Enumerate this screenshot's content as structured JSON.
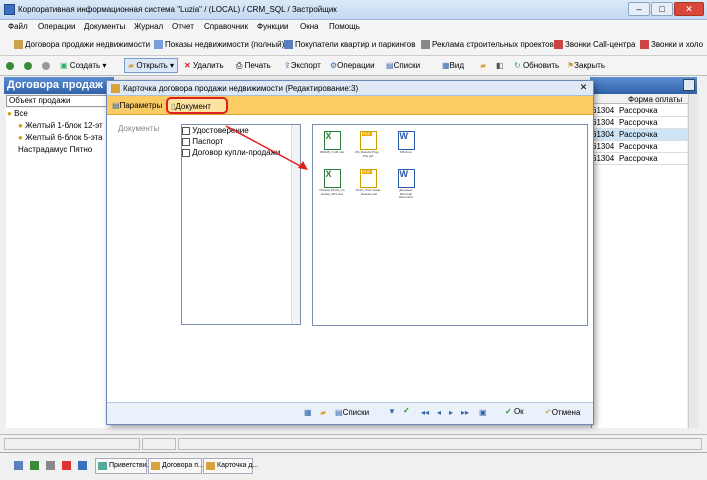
{
  "window": {
    "title": "Корпоративная информационная система \"Luzia\" / (LOCAL) / CRM_SQL / Застройщик",
    "min": "‒",
    "max": "□",
    "close": "✕"
  },
  "menu": [
    "Файл",
    "Операции",
    "Документы",
    "Журнал",
    "Отчет",
    "Справочник",
    "Функции",
    "Окна",
    "Помощь"
  ],
  "toolbar1": [
    "Договора продажи недвижимости",
    "Показы недвижимости (полный)",
    "Покупатели квартир и паркингов",
    "Реклама строительных проектов",
    "Звонки Call-центра",
    "Звонки и холо"
  ],
  "toolbar2": {
    "create": "Создать",
    "open": "Открыть",
    "delete": "Удалить",
    "print": "Печать",
    "export": "Экспорт",
    "operations": "Операции",
    "lists": "Списки",
    "view": "Вид",
    "refresh": "Обновить",
    "close": "Закрыть"
  },
  "section": {
    "title": "Договора продаж",
    "filter": "Объект продажи"
  },
  "tree": [
    "Все",
    "Желтый 1-блок 12-эт",
    "Желтый 6-блок 5-эта",
    "Настрадамус Пятно"
  ],
  "grid": {
    "header": "Форма оплаты",
    "rows": [
      {
        "code": "61304",
        "payment": "Рассрочка"
      },
      {
        "code": "61304",
        "payment": "Рассрочка"
      },
      {
        "code": "61304",
        "payment": "Рассрочка"
      },
      {
        "code": "61304",
        "payment": "Рассрочка"
      },
      {
        "code": "61304",
        "payment": "Рассрочка"
      }
    ]
  },
  "dialog": {
    "title": "Карточка договора продажи недвижимости (Редактирование:3)",
    "tab_params": "Параметры",
    "tab_document": "Документ",
    "docs_label": "Документы",
    "doc_types": [
      "Удостоверение",
      "Паспорт",
      "Договор купли-продажи"
    ],
    "files": [
      {
        "name": "MKD25_C HK.xlsx",
        "type": "excel"
      },
      {
        "name": "DS_Results Prog... PrLi.pdf",
        "type": "pdf"
      },
      {
        "name": "MS.docx",
        "type": "word"
      },
      {
        "name": "Pricelist PTHH_Co stroitel_28.0.xlsx",
        "type": "excel"
      },
      {
        "name": "SLSC_User Guide _Russian.pdf",
        "type": "pdf"
      },
      {
        "name": "Документ Microsoft Word.docx",
        "type": "word"
      }
    ],
    "footer": {
      "lists": "Списки",
      "ok": "Ок",
      "cancel": "Отмена"
    }
  },
  "taskbar": [
    "Приветстви...",
    "Договора п...",
    "Карточка д..."
  ],
  "colors": {
    "accent": "#fbcc64",
    "highlight": "#e02020",
    "selection": "#cde4f7"
  }
}
